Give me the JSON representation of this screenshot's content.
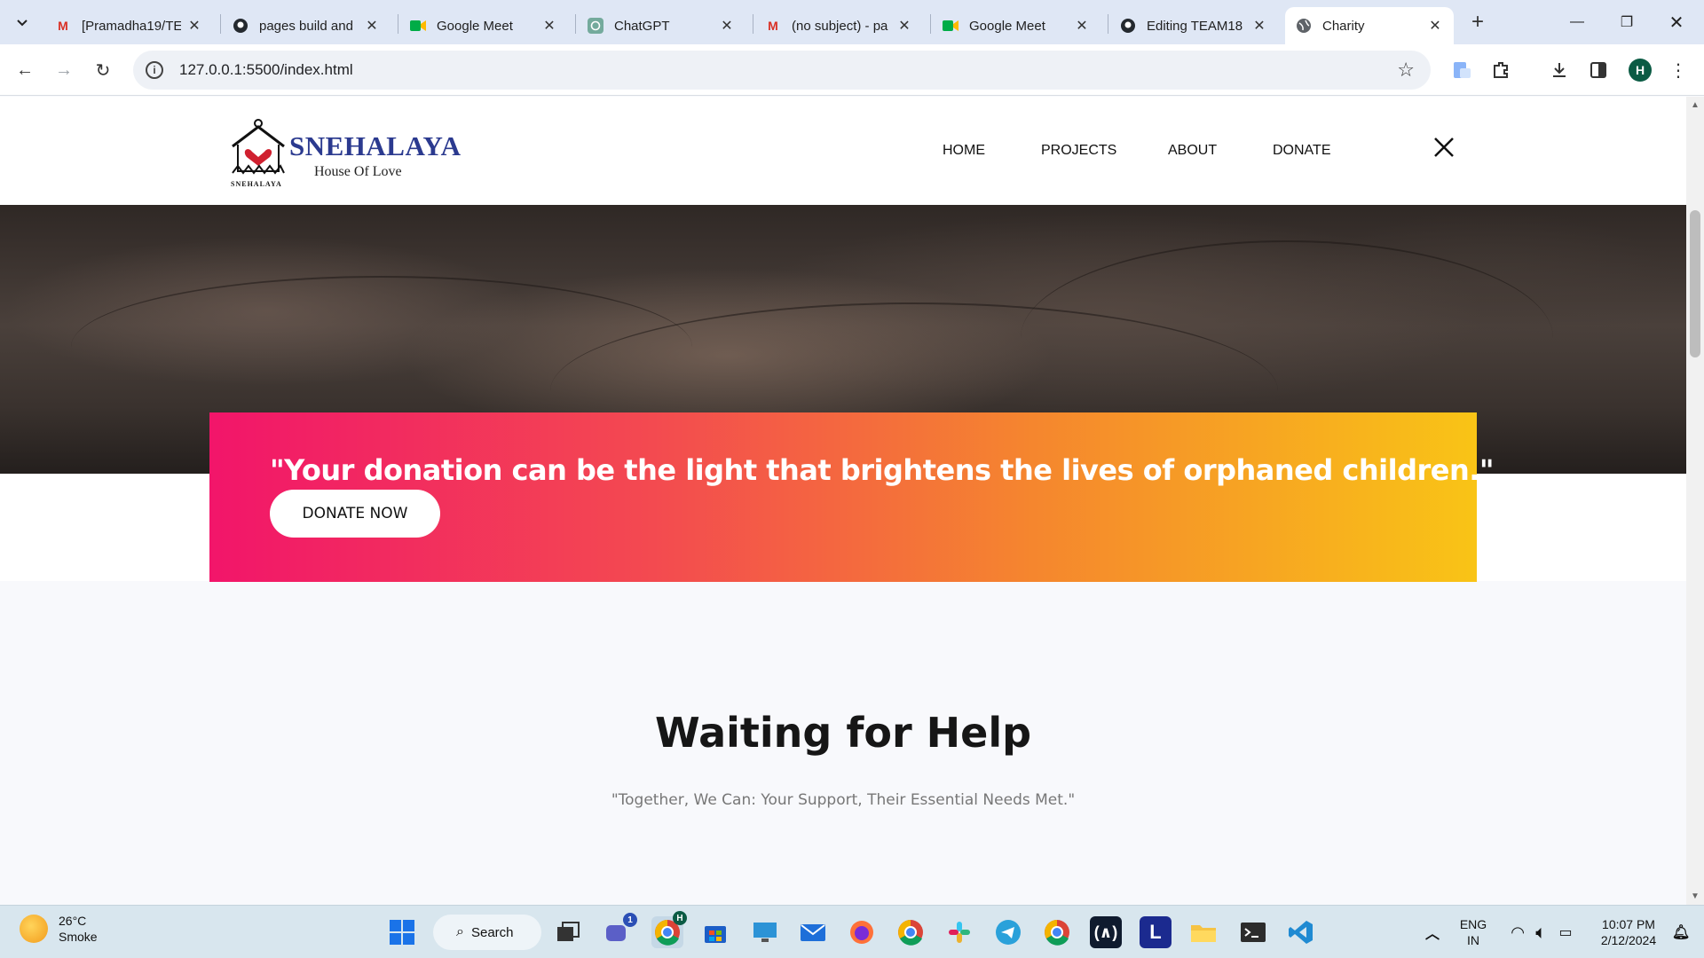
{
  "browser": {
    "tabs": [
      {
        "title": "[Pramadha19/TE",
        "icon": "gmail-icon"
      },
      {
        "title": "pages build and",
        "icon": "github-icon"
      },
      {
        "title": "Google Meet",
        "icon": "meet-icon"
      },
      {
        "title": "ChatGPT",
        "icon": "chatgpt-icon"
      },
      {
        "title": "(no subject) - pa",
        "icon": "gmail-icon"
      },
      {
        "title": "Google Meet",
        "icon": "meet-icon"
      },
      {
        "title": "Editing TEAM18",
        "icon": "github-icon"
      },
      {
        "title": "Charity",
        "icon": "globe-icon",
        "active": true
      }
    ],
    "url": "127.0.0.1:5500/index.html",
    "profile_initial": "H"
  },
  "site": {
    "brand": "SNEHALAYA",
    "tagline": "House Of Love",
    "logo_small_text": "SNEHALAYA",
    "nav": [
      "HOME",
      "PROJECTS",
      "ABOUT",
      "DONATE"
    ],
    "banner": {
      "quote": "\"Your donation can be the light that brightens the lives of orphaned children.\"",
      "button": "DONATE NOW"
    },
    "section": {
      "title": "Waiting for Help",
      "subtitle": "\"Together, We Can: Your Support, Their Essential Needs Met.\""
    }
  },
  "taskbar": {
    "weather_temp": "26°C",
    "weather_desc": "Smoke",
    "search_label": "Search",
    "teams_badge": "1",
    "chrome_badge": "H",
    "lang_line1": "ENG",
    "lang_line2": "IN",
    "time": "10:07 PM",
    "date": "2/12/2024"
  },
  "colors": {
    "banner_start": "#f2156a",
    "banner_end": "#f9c416",
    "brand": "#2b3a8f"
  }
}
